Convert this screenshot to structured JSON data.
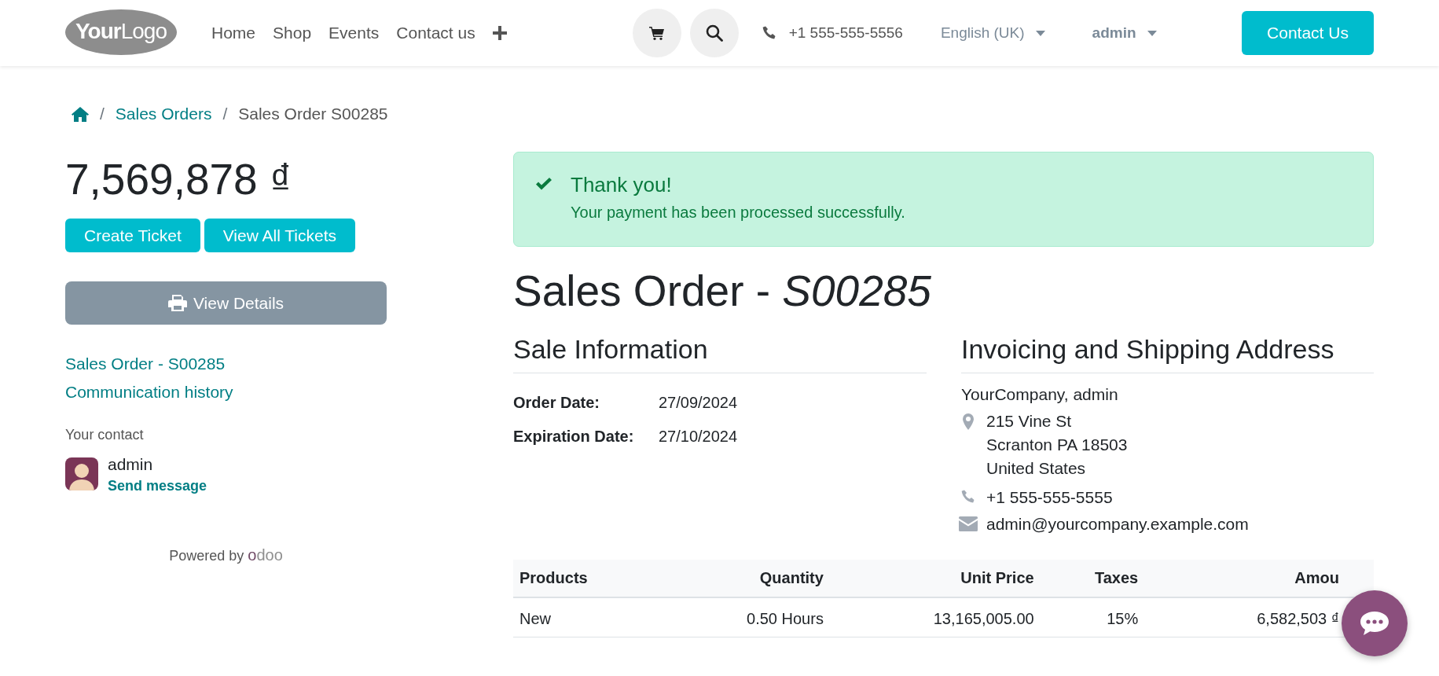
{
  "header": {
    "logo": "**Your**Logo",
    "nav": [
      "Home",
      "Shop",
      "Events",
      "Contact us"
    ],
    "phone": "+1 555-555-5556",
    "language": "English (UK)",
    "user": "admin",
    "cta": "Contact Us"
  },
  "breadcrumb": {
    "separator": "/",
    "items": [
      "Sales Orders",
      "Sales Order S00285"
    ]
  },
  "sidebar": {
    "amount": "7,569,878 ₫",
    "buttons": [
      "Create Ticket",
      "View All Tickets"
    ],
    "details_button": "View Details",
    "links": [
      "Sales Order - S00285",
      "Communication history"
    ],
    "contact_label": "Your contact",
    "contact_name": "admin",
    "contact_action": "Send message",
    "powered_by": "Powered by",
    "brand": "odoo"
  },
  "alert": {
    "title": "Thank you!",
    "message": "Your payment has been processed successfully."
  },
  "title": "Sales Order - *S00285*",
  "sale_info": {
    "heading": "Sale Information",
    "fields": [
      {
        "label": "Order Date:",
        "value": "27/09/2024"
      },
      {
        "label": "Expiration Date:",
        "value": "27/10/2024"
      }
    ]
  },
  "address": {
    "heading": "Invoicing and Shipping Address",
    "name": "YourCompany, admin",
    "street_lines": [
      "215 Vine St",
      "Scranton PA 18503",
      "United States"
    ],
    "phone": "+1 555-555-5555",
    "email": "admin@yourcompany.example.com"
  },
  "table": {
    "columns": [
      "Products",
      "Quantity",
      "Unit Price",
      "Taxes",
      "Amou"
    ],
    "rows": [
      {
        "cells": [
          "New",
          "0.50 Hours",
          "13,165,005.00",
          "15%",
          "6,582,503 ₫"
        ]
      }
    ]
  }
}
